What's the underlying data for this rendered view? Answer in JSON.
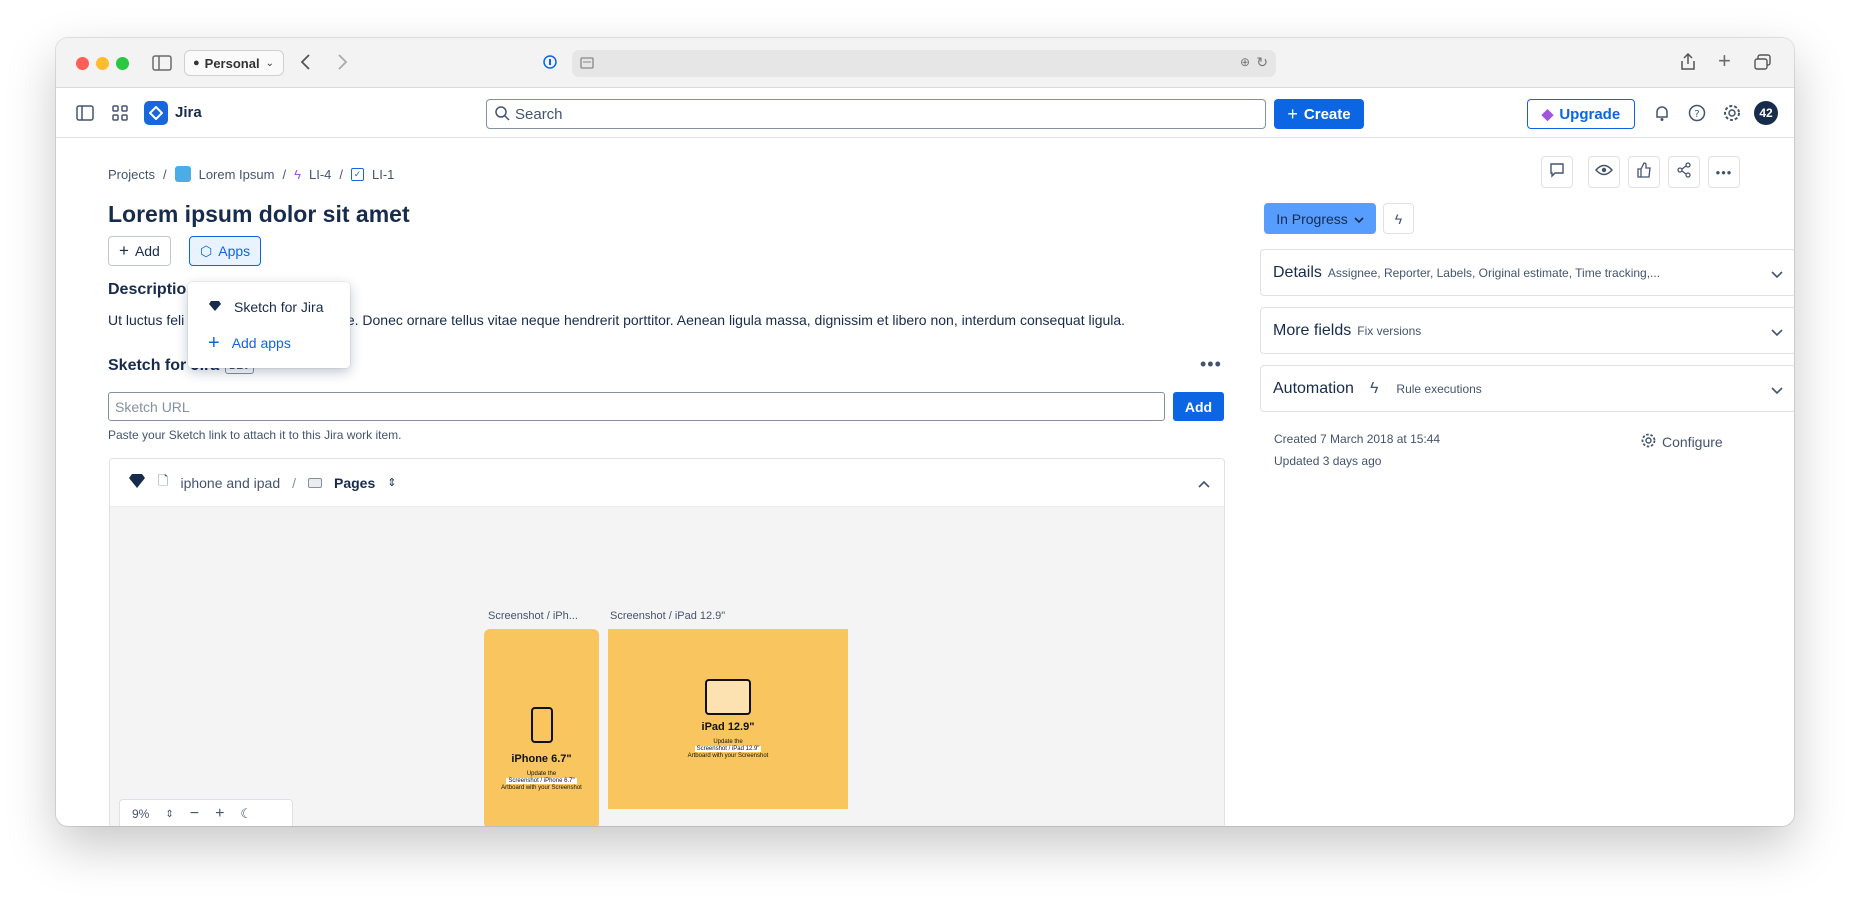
{
  "browser": {
    "profile_label": "Personal",
    "colors": {
      "close": "#ff5f57",
      "minimize": "#febc2e",
      "maximize": "#28c840"
    }
  },
  "header": {
    "app_name": "Jira",
    "search_placeholder": "Search",
    "create_label": "Create",
    "upgrade_label": "Upgrade",
    "avatar_text": "42"
  },
  "breadcrumb": {
    "projects": "Projects",
    "project": "Lorem Ipsum",
    "epic": "LI-4",
    "issue": "LI-1"
  },
  "issue": {
    "title": "Lorem ipsum dolor sit amet",
    "add_label": "Add",
    "apps_label": "Apps",
    "description_heading": "Descriptio",
    "description_start": "Ut luctus feli",
    "description_rest": "tate. Donec ornare tellus vitae neque hendrerit porttitor. Aenean ligula massa, dignissim et libero non, interdum consequat ligula."
  },
  "apps_menu": {
    "items": [
      {
        "label": "Sketch for Jira",
        "icon": "sketch-diamond-icon"
      },
      {
        "label": "Add apps",
        "icon": "plus-icon"
      }
    ]
  },
  "sketch": {
    "title": "Sketch for Jira",
    "badge": "DEV",
    "url_placeholder": "Sketch URL",
    "add_label": "Add",
    "helper": "Paste your Sketch link to attach it to this Jira work item.",
    "document": "iphone and ipad",
    "pages_label": "Pages",
    "artboards": [
      {
        "label": "Screenshot / iPh...",
        "device": "iPhone 6.7\"",
        "caption1": "Update the",
        "caption2": "Screenshot / iPhone 6.7\"",
        "caption3": "Artboard with your Screenshot"
      },
      {
        "label": "Screenshot / iPad 12.9\"",
        "device": "iPad 12.9\"",
        "caption1": "Update the",
        "caption2": "Screenshot / iPad 12.9\"",
        "caption3": "Artboard with your Screenshot"
      }
    ],
    "zoom": "9%",
    "artboard_color": "#f8c55e"
  },
  "sidebar": {
    "status": "In Progress",
    "panels": [
      {
        "title": "Details",
        "sub": "Assignee, Reporter, Labels, Original estimate, Time tracking,..."
      },
      {
        "title": "More fields",
        "sub": "Fix versions"
      },
      {
        "title": "Automation",
        "sub": "Rule executions"
      }
    ],
    "created": "Created 7 March 2018 at 15:44",
    "updated": "Updated 3 days ago",
    "configure_label": "Configure"
  }
}
